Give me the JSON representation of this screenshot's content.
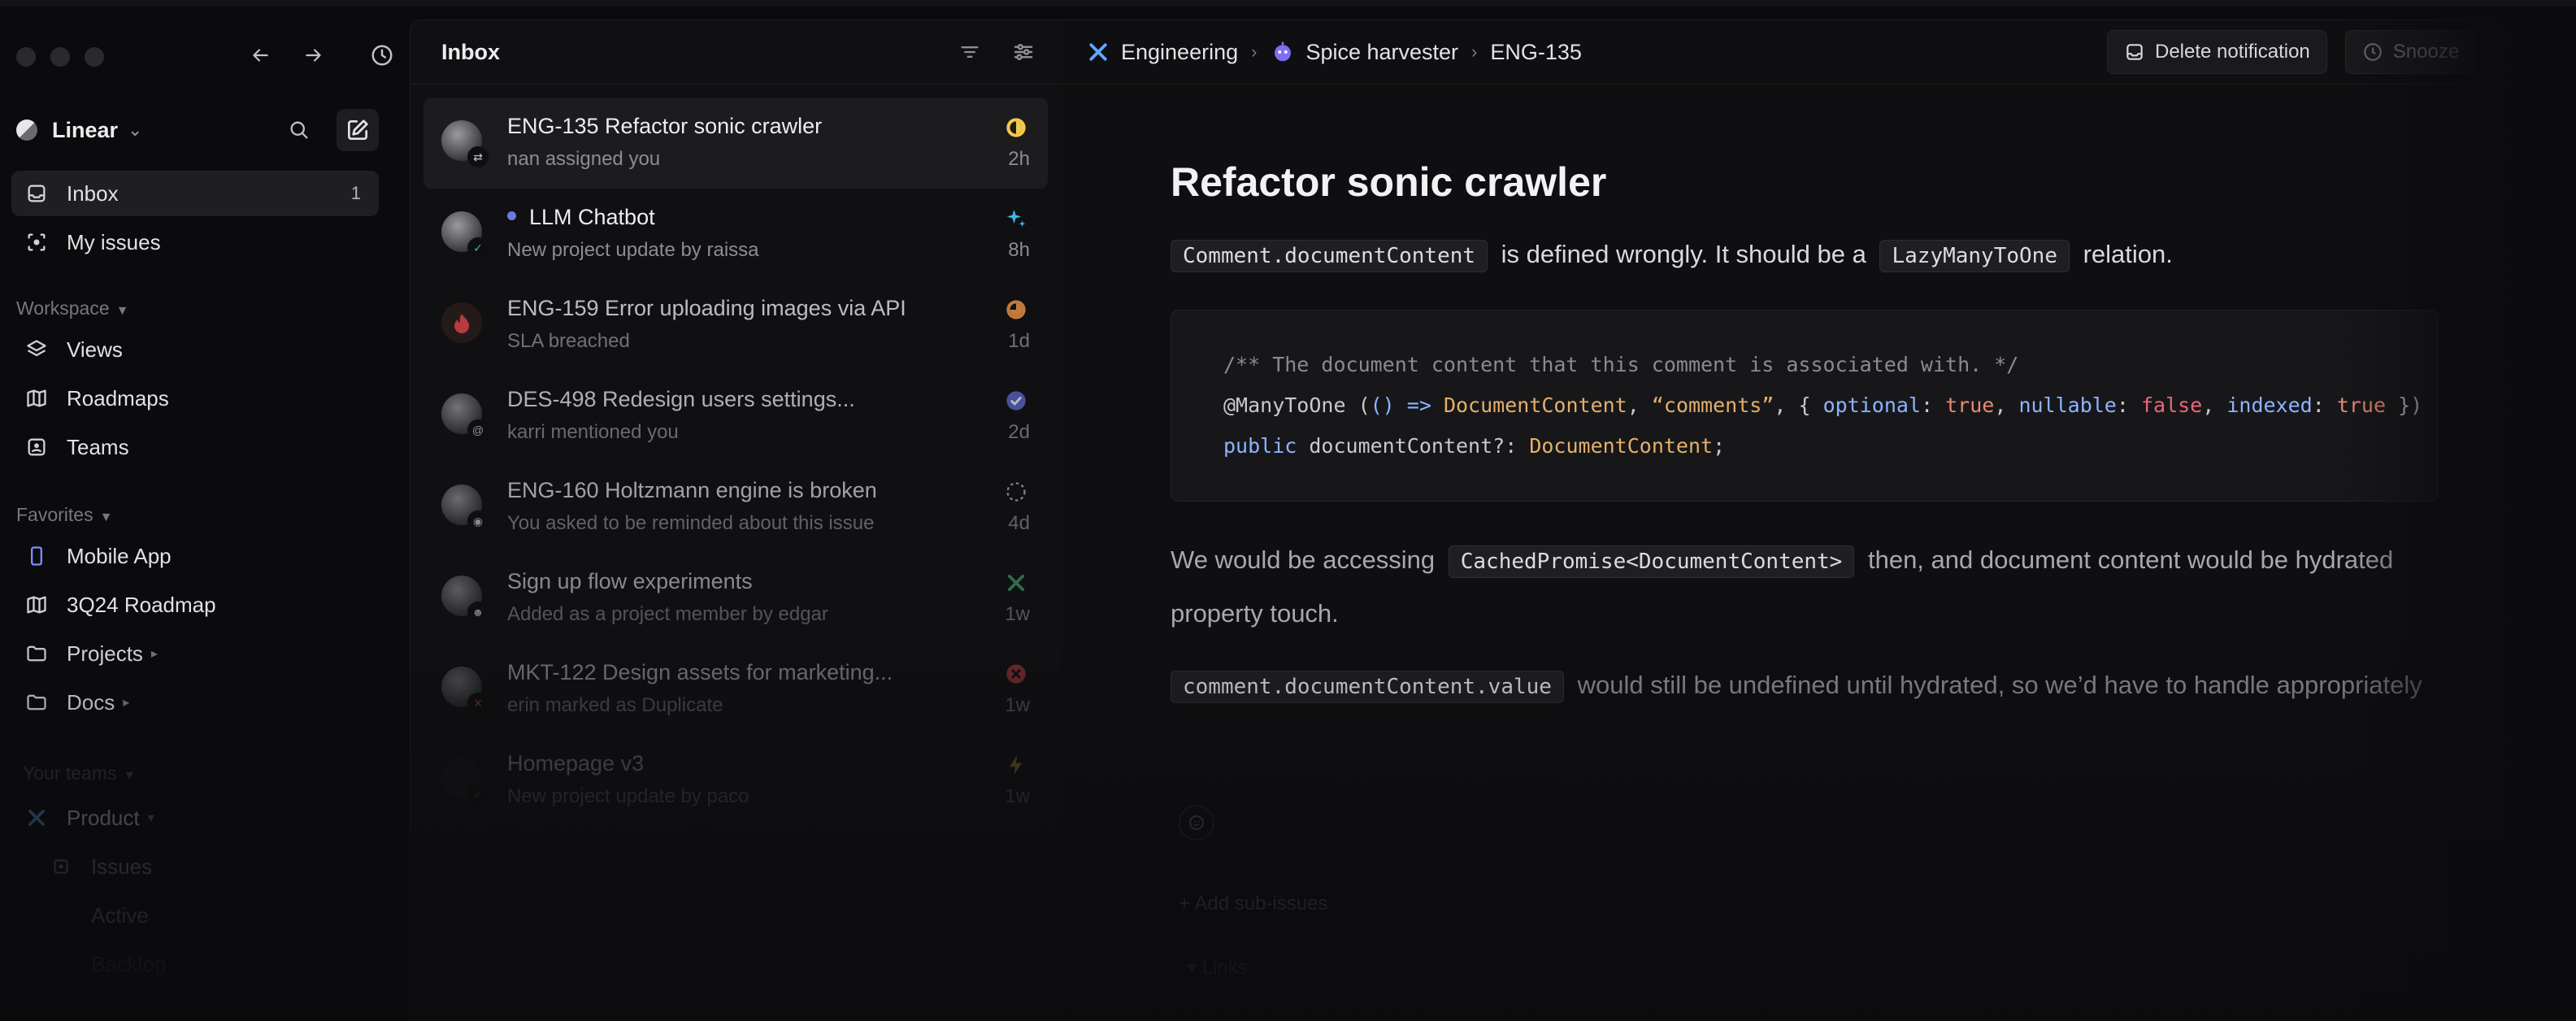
{
  "app": {
    "workspace_name": "Linear"
  },
  "sidebar": {
    "nav": [
      {
        "label": "Inbox",
        "count": "1"
      },
      {
        "label": "My issues"
      }
    ],
    "workspace_label": "Workspace",
    "workspace_items": [
      {
        "label": "Views"
      },
      {
        "label": "Roadmaps"
      },
      {
        "label": "Teams"
      }
    ],
    "favorites_label": "Favorites",
    "favorites": [
      {
        "label": "Mobile App"
      },
      {
        "label": "3Q24 Roadmap"
      },
      {
        "label": "Projects"
      },
      {
        "label": "Docs"
      }
    ],
    "teams_label": "Your teams",
    "team": {
      "name": "Product",
      "items": [
        "Issues",
        "Active",
        "Backlog"
      ]
    }
  },
  "inbox": {
    "title": "Inbox",
    "items": [
      {
        "title": "ENG-135 Refactor sonic crawler",
        "subtitle": "nan assigned you",
        "age": "2h",
        "status_icon": "in-progress-icon"
      },
      {
        "title": "LLM Chatbot",
        "subtitle": "New project update by raissa",
        "age": "8h",
        "status_icon": "sparkle-icon"
      },
      {
        "title": "ENG-159 Error uploading images via API",
        "subtitle": "SLA breached",
        "age": "1d",
        "status_icon": "sla-breached-icon"
      },
      {
        "title": "DES-498 Redesign users settings...",
        "subtitle": "karri mentioned you",
        "age": "2d",
        "status_icon": "done-check-icon"
      },
      {
        "title": "ENG-160 Holtzmann engine is broken",
        "subtitle": "You asked to be reminded about this issue",
        "age": "4d",
        "status_icon": "backlog-icon"
      },
      {
        "title": "Sign up flow experiments",
        "subtitle": "Added as a project member by edgar",
        "age": "1w",
        "status_icon": "project-icon"
      },
      {
        "title": "MKT-122 Design assets for marketing...",
        "subtitle": "erin marked as Duplicate",
        "age": "1w",
        "status_icon": "canceled-icon"
      },
      {
        "title": "Homepage v3",
        "subtitle": "New project update by paco",
        "age": "1w",
        "status_icon": "bolt-icon"
      }
    ]
  },
  "detail": {
    "breadcrumb": [
      "Engineering",
      "Spice harvester",
      "ENG-135"
    ],
    "actions": {
      "delete": "Delete notification",
      "snooze": "Snooze"
    },
    "title": "Refactor sonic crawler",
    "p1": {
      "code1": "Comment.documentContent",
      "text1": "is defined wrongly. It should be a",
      "code2": "LazyManyToOne",
      "text2": "relation."
    },
    "code": {
      "line1": "/** The document content that this comment is associated with. */",
      "line2_decorator": "@ManyToOne",
      "line2_arrow": "() =>",
      "line2_type": "DocumentContent",
      "line2_str": "“comments”",
      "line2_optional": "optional",
      "line2_true": "true",
      "line2_nullable": "nullable",
      "line2_false": "false",
      "line2_indexed": "indexed",
      "line2_true2": "true",
      "line3_kw": "public",
      "line3_prop": "documentContent?:",
      "line3_type": "DocumentContent"
    },
    "p2": {
      "text1": "We would be accessing",
      "code": "CachedPromise<DocumentContent>",
      "text2": "then, and document content would be hydrated",
      "text3": "property touch."
    },
    "p3": {
      "code": "comment.documentContent.value",
      "text": "would still be undefined until hydrated, so we’d have to handle appropriately"
    },
    "add_sub_issues": "+ Add sub-issues",
    "links": "▾ Links"
  }
}
